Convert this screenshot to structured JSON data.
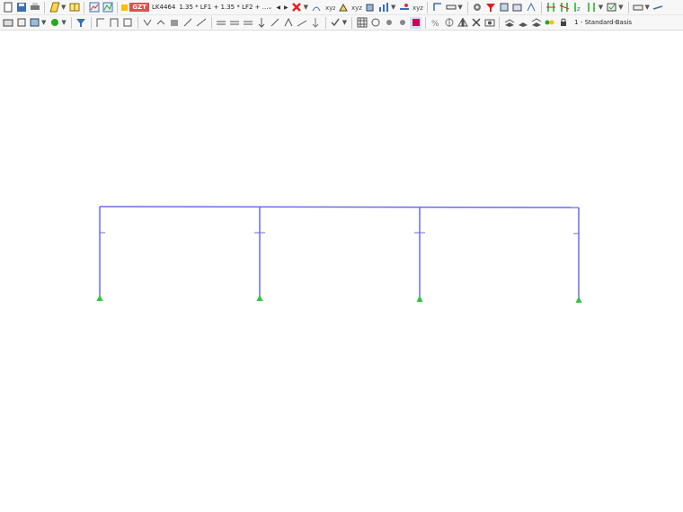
{
  "toolbar1": {
    "load_combination": {
      "badge_text": "GZT",
      "id": "LK4464",
      "formula": "1.35 * LF1 + 1.35 * LF2 + ..."
    }
  },
  "toolbar2": {
    "view_selector": "1 - Standard-Basis"
  },
  "colors": {
    "member": "#6b6bea",
    "support": "#2fc23e",
    "badge": "#e05050",
    "load_case_swatch": "#ffbe00",
    "background": "#ffffff"
  },
  "icons": [
    "new-file-icon",
    "save-icon",
    "print-icon",
    "edit-mode-icon",
    "table-icon",
    "results-icon",
    "member-icon",
    "red-close-icon",
    "filter-icon",
    "section-icon",
    "support-icon",
    "node-icon",
    "view-cube-icon",
    "render-icon",
    "layer-icon"
  ]
}
